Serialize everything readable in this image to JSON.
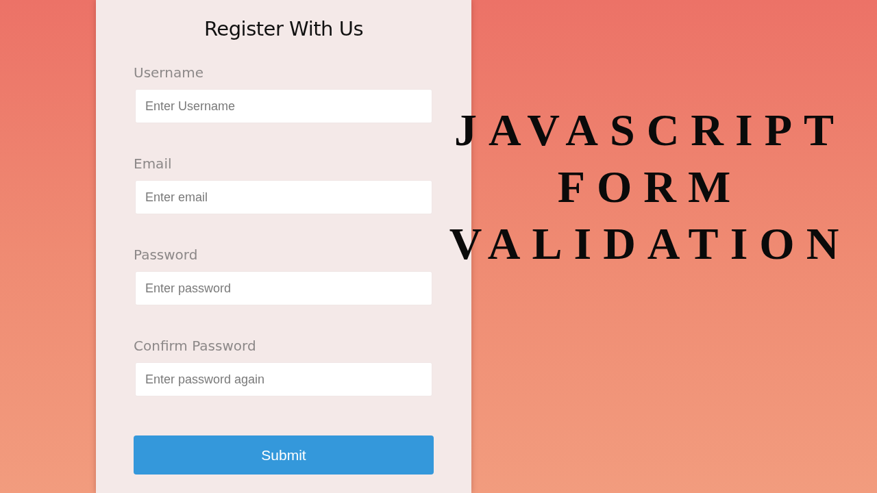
{
  "form": {
    "title": "Register With Us",
    "fields": [
      {
        "label": "Username",
        "placeholder": "Enter Username"
      },
      {
        "label": "Email",
        "placeholder": "Enter email"
      },
      {
        "label": "Password",
        "placeholder": "Enter password"
      },
      {
        "label": "Confirm Password",
        "placeholder": "Enter password again"
      }
    ],
    "submit_button": "Submit"
  },
  "headline": [
    "JAVASCRIPT",
    "FORM",
    "VALIDATION"
  ]
}
